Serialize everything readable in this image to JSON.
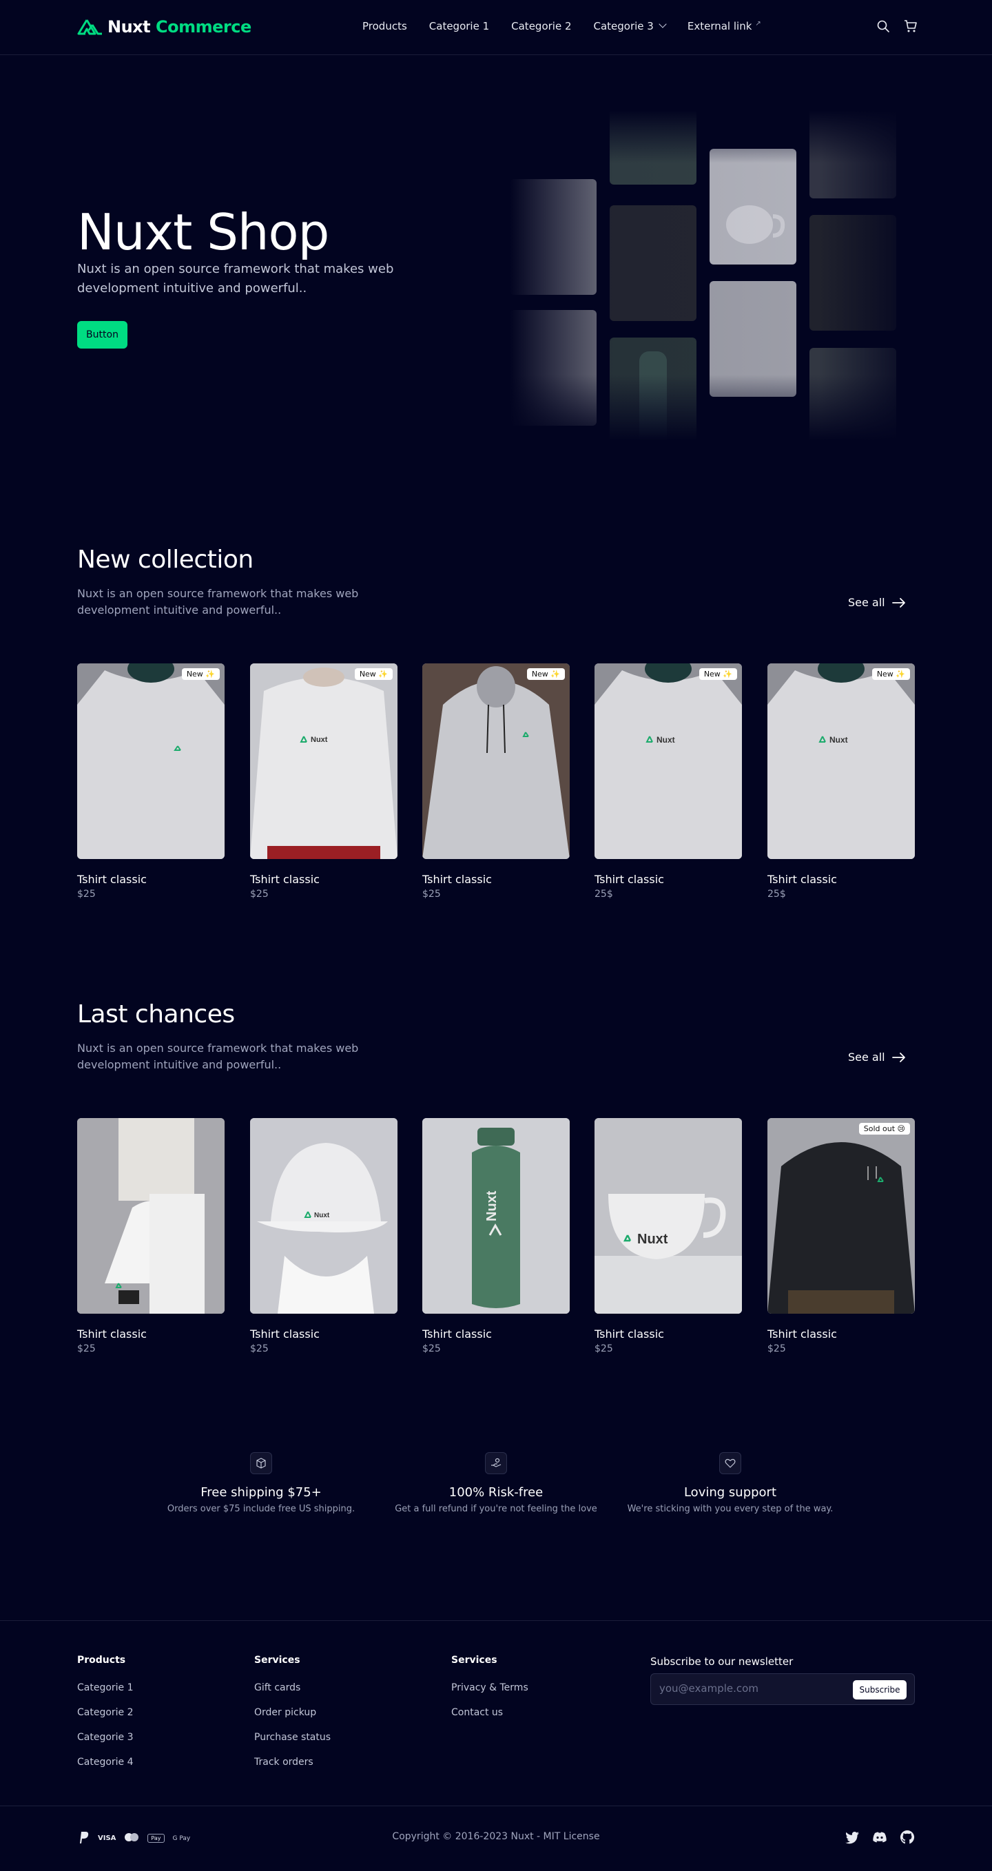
{
  "brand": {
    "name_part1": "Nuxt",
    "name_part2": "Commerce",
    "accent_color": "#00dc82",
    "background_color": "#020420"
  },
  "nav": {
    "items": [
      {
        "label": "Products"
      },
      {
        "label": "Categorie 1"
      },
      {
        "label": "Categorie 2"
      },
      {
        "label": "Categorie 3",
        "icon": "chevron-down-icon"
      },
      {
        "label": "External link",
        "icon": "external-link-icon",
        "icon_glyph": "↗"
      }
    ],
    "icons": [
      "search-icon",
      "cart-icon"
    ]
  },
  "hero": {
    "title": "Nuxt Shop",
    "description": "Nuxt is an open source framework that makes web development intuitive and powerful..",
    "button_label": "Button"
  },
  "new_collection": {
    "title": "New collection",
    "description": "Nuxt is an open source framework that makes web development intuitive and powerful..",
    "see_all": "See all",
    "products": [
      {
        "name": "Tshirt classic",
        "price": "$25",
        "badge": "New ✨"
      },
      {
        "name": "Tshirt classic",
        "price": "$25",
        "badge": "New ✨"
      },
      {
        "name": "Tshirt classic",
        "price": "$25",
        "badge": "New ✨"
      },
      {
        "name": "Tshirt classic",
        "price": "25$",
        "badge": "New ✨"
      },
      {
        "name": "Tshirt classic",
        "price": "25$",
        "badge": "New ✨"
      }
    ]
  },
  "last_chances": {
    "title": "Last chances",
    "description": "Nuxt is an open source framework that makes web development intuitive and powerful..",
    "see_all": "See all",
    "products": [
      {
        "name": "Tshirt classic",
        "price": "$25"
      },
      {
        "name": "Tshirt classic",
        "price": "$25"
      },
      {
        "name": "Tshirt classic",
        "price": "$25"
      },
      {
        "name": "Tshirt classic",
        "price": "$25"
      },
      {
        "name": "Tshirt classic",
        "price": "$25",
        "badge": "Sold out 😢"
      }
    ]
  },
  "features": [
    {
      "title": "Free shipping $75+",
      "description": "Orders over $75 include free US shipping.",
      "icon": "box-icon"
    },
    {
      "title": "100% Risk-free",
      "description": "Get a full refund if you're not feeling the love",
      "icon": "hand-coins-icon"
    },
    {
      "title": "Loving support",
      "description": "We're sticking with you every step of the way.",
      "icon": "heart-icon"
    }
  ],
  "footer": {
    "columns": [
      {
        "heading": "Products",
        "links": [
          "Categorie 1",
          "Categorie 2",
          "Categorie 3",
          "Categorie 4"
        ]
      },
      {
        "heading": "Services",
        "links": [
          "Gift cards",
          "Order pickup",
          "Purchase status",
          "Track orders"
        ]
      },
      {
        "heading": "Services",
        "links": [
          "Privacy & Terms",
          "Contact us"
        ]
      }
    ],
    "newsletter": {
      "heading": "Subscribe to our newsletter",
      "placeholder": "you@example.com",
      "button_label": "Subscribe"
    },
    "payment_icons": [
      "paypal-icon",
      "visa-icon",
      "mastercard-icon",
      "apple-pay-icon",
      "google-pay-icon"
    ],
    "payment_labels": {
      "visa": "VISA",
      "apple_pay": "Pay",
      "google_pay": "G Pay"
    },
    "copyright": "Copyright © 2016-2023 Nuxt - MIT License",
    "social_icons": [
      "twitter-icon",
      "discord-icon",
      "github-icon"
    ]
  }
}
